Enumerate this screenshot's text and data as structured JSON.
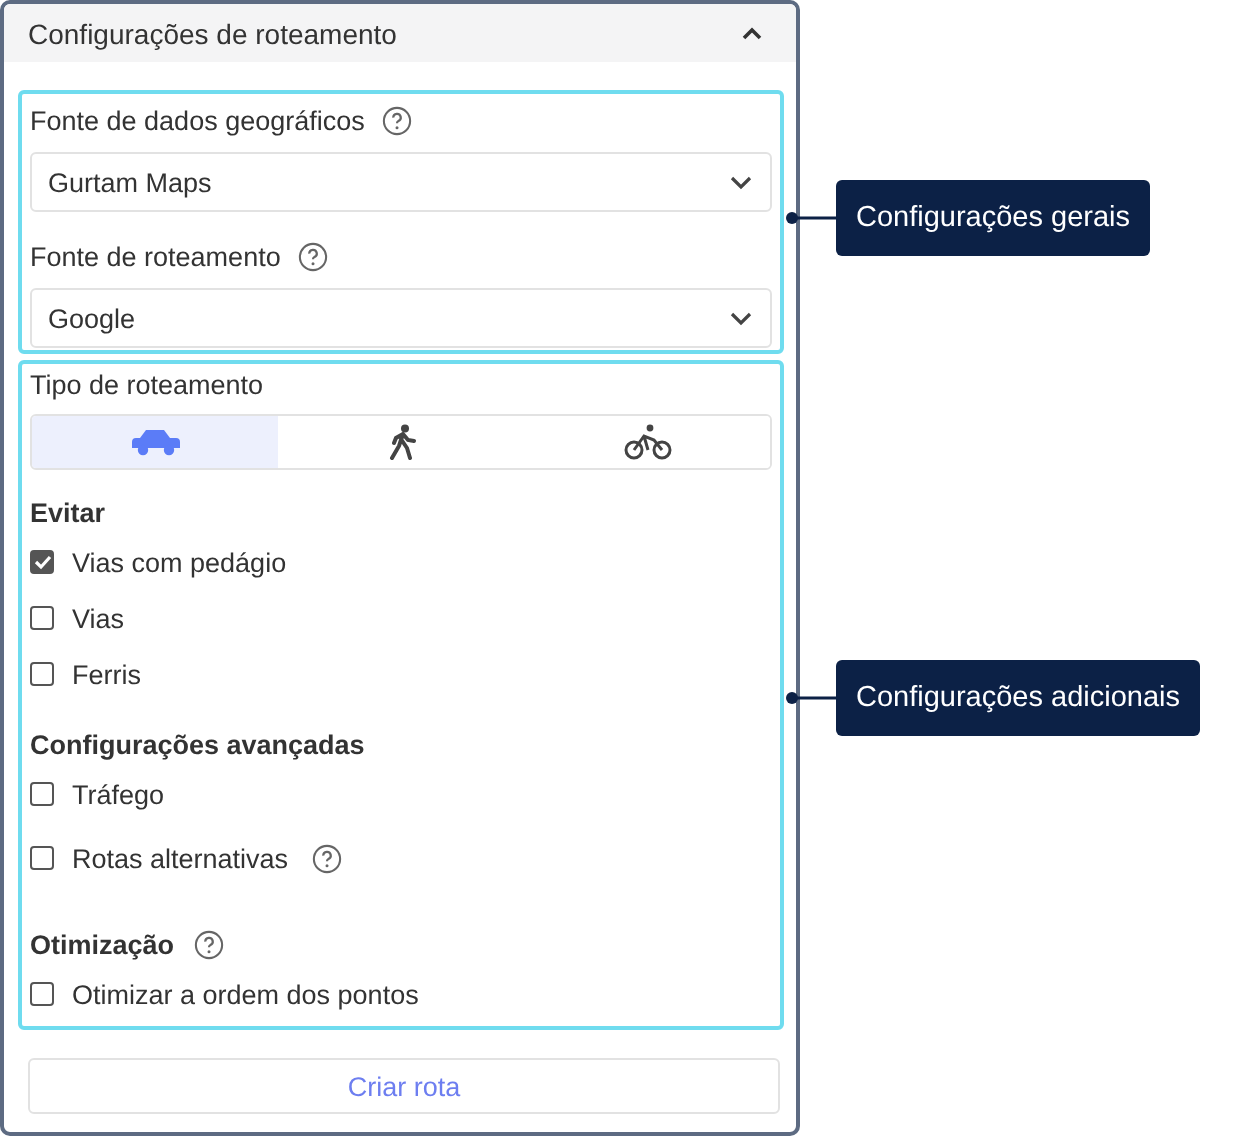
{
  "panel": {
    "title": "Configurações de roteamento",
    "expanded": true
  },
  "general": {
    "fields": [
      {
        "label": "Fonte de dados geográficos",
        "help": true,
        "value": "Gurtam Maps"
      },
      {
        "label": "Fonte de roteamento",
        "help": true,
        "value": "Google"
      }
    ]
  },
  "additional": {
    "type_label": "Tipo de roteamento",
    "modes": [
      {
        "kind": "car",
        "selected": true
      },
      {
        "kind": "walk",
        "selected": false
      },
      {
        "kind": "bike",
        "selected": false
      }
    ],
    "sections": [
      {
        "title": "Evitar",
        "help": false,
        "options": [
          {
            "label": "Vias com pedágio",
            "checked": true,
            "help": false
          },
          {
            "label": "Vias",
            "checked": false,
            "help": false
          },
          {
            "label": "Ferris",
            "checked": false,
            "help": false
          }
        ]
      },
      {
        "title": "Configurações avançadas",
        "help": false,
        "options": [
          {
            "label": "Tráfego",
            "checked": false,
            "help": false
          },
          {
            "label": "Rotas alternativas",
            "checked": false,
            "help": true
          }
        ]
      },
      {
        "title": "Otimização",
        "help": true,
        "options": [
          {
            "label": "Otimizar a ordem dos pontos",
            "checked": false,
            "help": false
          }
        ]
      }
    ]
  },
  "button": "Criar rota",
  "callouts": [
    {
      "label": "Configurações gerais"
    },
    {
      "label": "Configurações adicionais"
    }
  ]
}
